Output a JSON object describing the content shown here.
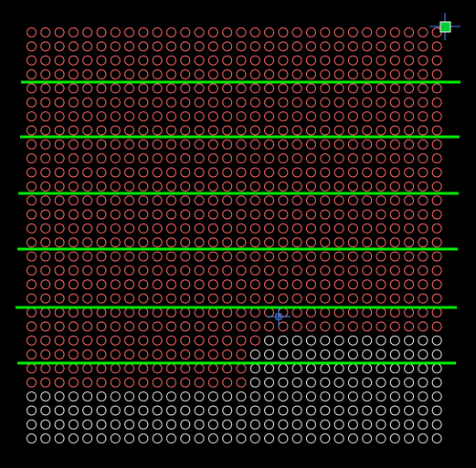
{
  "colors": {
    "background": "#000000",
    "selected_marker": "#ff6666",
    "unselected_marker": "#e8e8e8",
    "separator_line": "#00ee00",
    "grip": "#00cc33",
    "crosshair": "#4d88ff"
  },
  "grid": {
    "columns": 30,
    "rows": 30,
    "selected_rows_full": 22,
    "selected_cols_partial_row_23": 17,
    "selected_cols_partial_rows_24_26": 16
  },
  "separators": {
    "count": 6,
    "after_rows": [
      4,
      8,
      12,
      16,
      20,
      24
    ]
  },
  "icons": {
    "grip": "grip-handle-icon",
    "crosshair": "crosshair-cursor-icon"
  }
}
